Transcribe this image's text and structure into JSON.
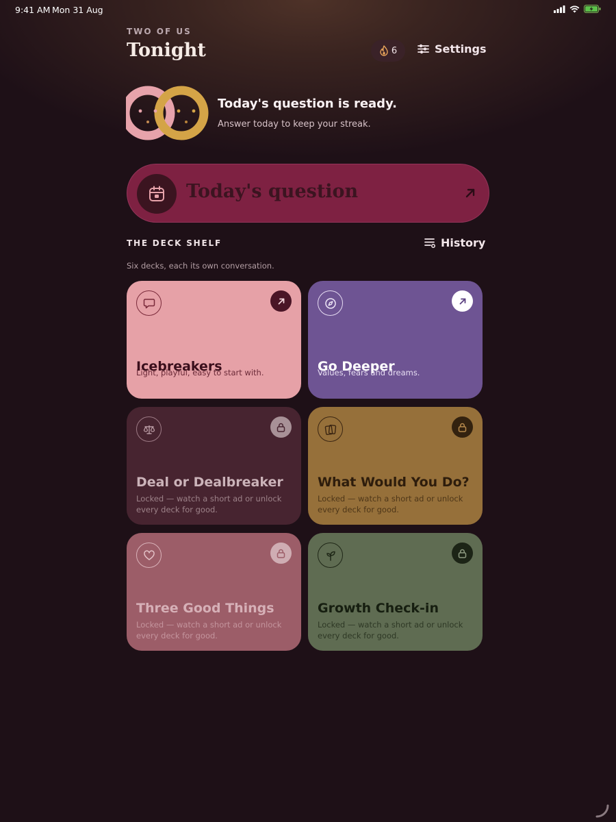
{
  "status_bar": {
    "time": "9:41 AM",
    "date": "Mon 31 Aug",
    "icons": [
      "cellular-signal-icon",
      "wifi-icon",
      "battery-charging-icon"
    ]
  },
  "header": {
    "eyebrow": "TWO OF US",
    "title": "Tonight",
    "streak_count": "6",
    "streak_icon": "flame-icon",
    "settings_label": "Settings",
    "settings_icon": "sliders-icon"
  },
  "banner": {
    "title": "Today's question is ready.",
    "subtitle": "Answer today to keep your streak.",
    "colors": {
      "left_ring": "#e7a3ab",
      "right_ring": "#d4a447"
    }
  },
  "today_button": {
    "label": "Today's question",
    "icon": "calendar-icon",
    "arrow_icon": "arrow-up-right-icon",
    "color": "#7e2142"
  },
  "deck_shelf": {
    "title": "THE DECK SHELF",
    "subtitle": "Six decks, each its own conversation.",
    "history_label": "History",
    "history_icon": "list-history-icon",
    "decks": [
      {
        "title": "Icebreakers",
        "description": "Light, playful, easy to start with.",
        "icon": "speech-bubble-icon",
        "badge_icon": "arrow-up-right-icon",
        "locked": false,
        "color": "#e6a1a7"
      },
      {
        "title": "Go Deeper",
        "description": "Values, fears and dreams.",
        "icon": "compass-icon",
        "badge_icon": "arrow-up-right-icon",
        "locked": false,
        "color": "#6e5493"
      },
      {
        "title": "Deal or Dealbreaker",
        "description": "Locked — watch a short ad or unlock every deck for good.",
        "icon": "scales-icon",
        "badge_icon": "lock-icon",
        "locked": true,
        "color": "#472430"
      },
      {
        "title": "What Would You Do?",
        "description": "Locked — watch a short ad or unlock every deck for good.",
        "icon": "cards-icon",
        "badge_icon": "lock-icon",
        "locked": true,
        "color": "#96703a"
      },
      {
        "title": "Three Good Things",
        "description": "Locked — watch a short ad or unlock every deck for good.",
        "icon": "heart-icon",
        "badge_icon": "lock-icon",
        "locked": true,
        "color": "#9c5d68"
      },
      {
        "title": "Growth Check-in",
        "description": "Locked — watch a short ad or unlock every deck for good.",
        "icon": "sprout-icon",
        "badge_icon": "lock-icon",
        "locked": true,
        "color": "#5f6c52"
      }
    ]
  }
}
